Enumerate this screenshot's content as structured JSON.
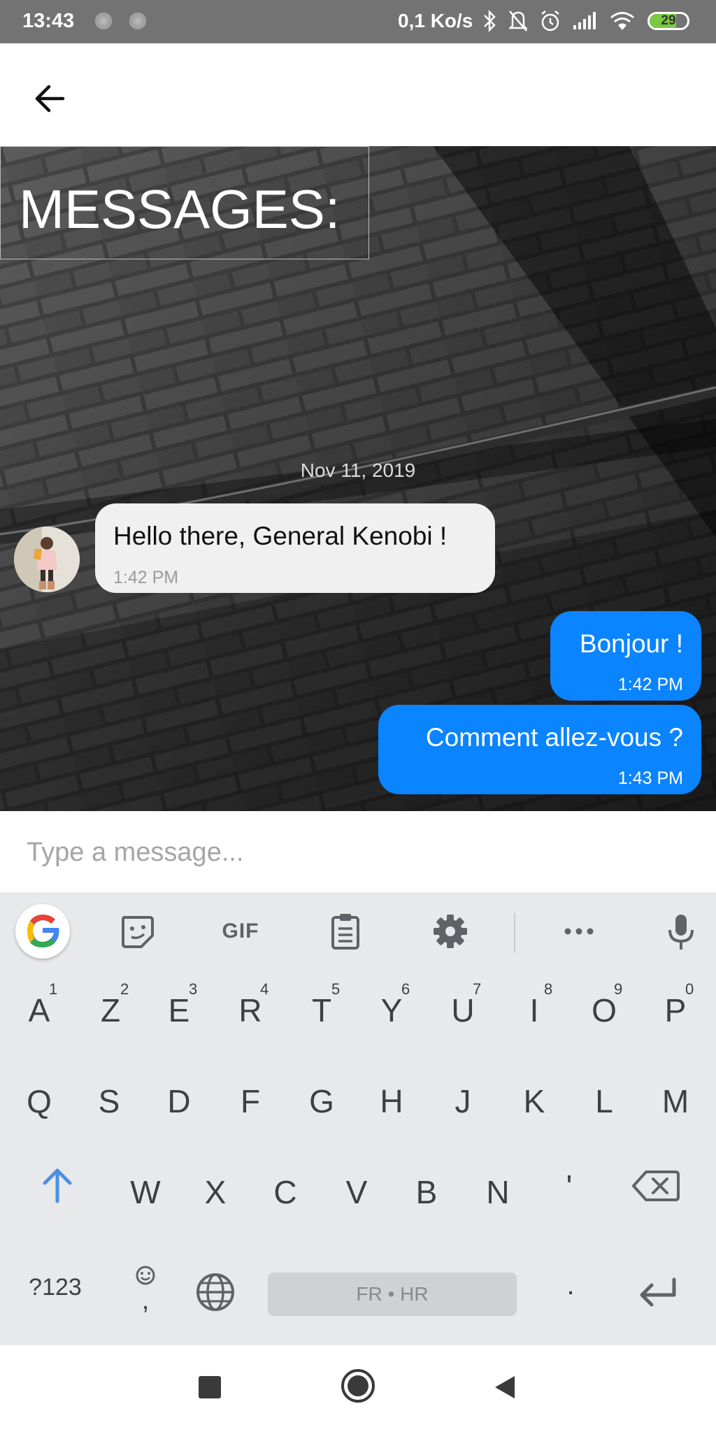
{
  "status_bar": {
    "time": "13:43",
    "net_speed": "0,1 Ko/s",
    "battery": "29",
    "icons": [
      "notification-dot-icon",
      "notification-dot-icon",
      "bluetooth-icon",
      "bell-off-icon",
      "alarm-icon",
      "signal-icon",
      "wifi-icon",
      "battery-icon"
    ]
  },
  "app_bar": {
    "back_icon": "arrow-left-icon"
  },
  "chat": {
    "title": "MESSAGES:",
    "date": "Nov 11, 2019",
    "messages": [
      {
        "direction": "incoming",
        "text": "Hello there, General Kenobi !",
        "time": "1:42 PM"
      },
      {
        "direction": "outgoing",
        "text": "Bonjour !",
        "time": "1:42 PM"
      },
      {
        "direction": "outgoing",
        "text": "Comment allez-vous ?",
        "time": "1:43 PM"
      }
    ],
    "outgoing_color": "#0a84ff",
    "incoming_color": "#f0f0f0"
  },
  "composer": {
    "placeholder": "Type a message..."
  },
  "keyboard": {
    "toolbar": [
      "google-icon",
      "sticker-icon",
      "gif-icon",
      "clipboard-icon",
      "settings-icon",
      "more-icon",
      "microphone-icon"
    ],
    "gif_label": "GIF",
    "row1": [
      {
        "k": "A",
        "n": "1"
      },
      {
        "k": "Z",
        "n": "2"
      },
      {
        "k": "E",
        "n": "3"
      },
      {
        "k": "R",
        "n": "4"
      },
      {
        "k": "T",
        "n": "5"
      },
      {
        "k": "Y",
        "n": "6"
      },
      {
        "k": "U",
        "n": "7"
      },
      {
        "k": "I",
        "n": "8"
      },
      {
        "k": "O",
        "n": "9"
      },
      {
        "k": "P",
        "n": "0"
      }
    ],
    "row2": [
      "Q",
      "S",
      "D",
      "F",
      "G",
      "H",
      "J",
      "K",
      "L",
      "M"
    ],
    "row3": [
      "W",
      "X",
      "C",
      "V",
      "B",
      "N",
      "'"
    ],
    "symbols_key": "?123",
    "comma_key": ",",
    "period_key": ".",
    "space_label": "FR • HR",
    "accent_color": "#4a90e2"
  },
  "nav_bar": {
    "buttons": [
      "recents-square-icon",
      "home-circle-icon",
      "back-triangle-icon"
    ]
  }
}
